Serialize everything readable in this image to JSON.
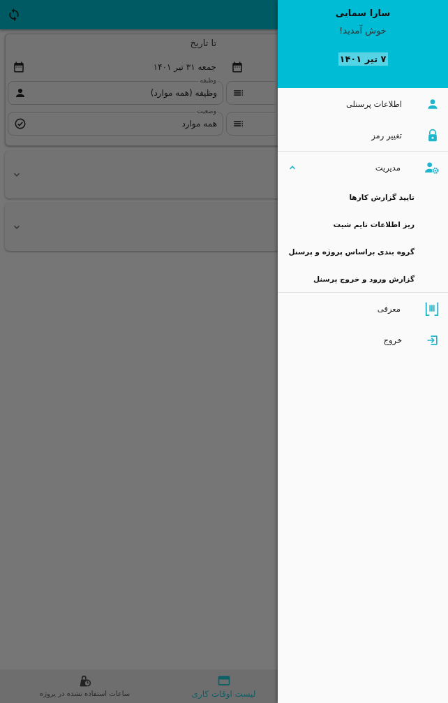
{
  "filter": {
    "to_date_label": "تا تاریخ",
    "to_date": "جمعه ۳۱ تیر ۱۴۰۱",
    "fields": [
      {
        "label": "وظیفه",
        "value": "وظیفه (همه موارد)",
        "kind": "person"
      },
      {
        "label": "وضعیت",
        "value": "همه موارد",
        "kind": "status"
      }
    ]
  },
  "cards": [
    {
      "expanded": false
    },
    {
      "expanded": false
    }
  ],
  "bottom_nav": [
    {
      "label": "لیست اوقات کاری",
      "selected": true,
      "kind": "card"
    },
    {
      "label": "ساعات استفاده نشده در پروژه",
      "selected": false,
      "kind": "clock"
    }
  ],
  "drawer": {
    "user_name": "سارا سمایی",
    "greeting": "خوش آمدید!",
    "date": "۷ تیر ۱۴۰۱",
    "items": [
      {
        "label": "اطلاعات پرسنلی",
        "kind": "person"
      },
      {
        "label": "تغییر رمز",
        "kind": "lock"
      },
      {
        "label": "مدیریت",
        "kind": "admin",
        "expanded": true,
        "children": [
          {
            "label": "تایید گزارش کارها"
          },
          {
            "label": "ریز اطلاعات تایم شیت"
          },
          {
            "label": "گروه بندی براساس پروژه و پرسنل"
          },
          {
            "label": "گزارش ورود و خروج پرسنل"
          }
        ]
      },
      {
        "label": "معرفی",
        "kind": "intro"
      },
      {
        "label": "خروج",
        "kind": "logout"
      }
    ]
  }
}
